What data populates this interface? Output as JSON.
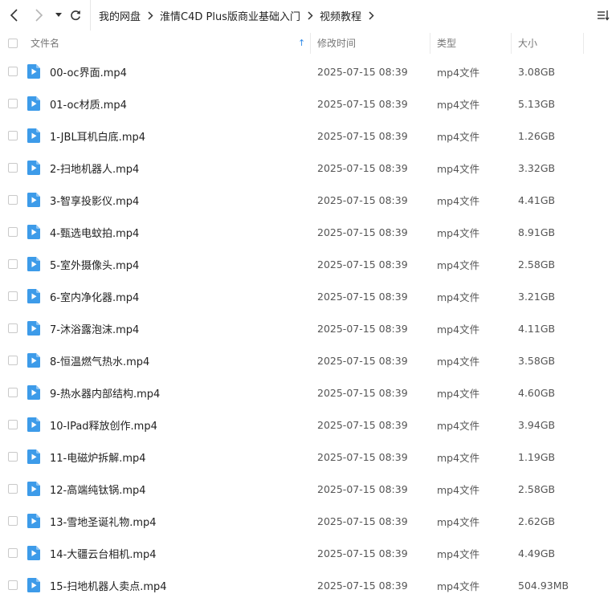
{
  "toolbar": {
    "back_icon": "chevron-left-icon",
    "forward_icon": "chevron-right-icon",
    "history_icon": "caret-down-icon",
    "refresh_icon": "refresh-icon",
    "sort_icon": "sort-list-icon",
    "breadcrumb": [
      "我的网盘",
      "淮情C4D Plus版商业基础入门",
      "视频教程"
    ]
  },
  "columns": {
    "name": "文件名",
    "modified": "修改时间",
    "type": "类型",
    "size": "大小",
    "sort_indicator": "↑"
  },
  "colors": {
    "file_icon": "#3d9be9",
    "sort_arrow": "#2f8ae8"
  },
  "files": [
    {
      "name": "00-oc界面.mp4",
      "modified": "2025-07-15 08:39",
      "type": "mp4文件",
      "size": "3.08GB"
    },
    {
      "name": "01-oc材质.mp4",
      "modified": "2025-07-15 08:39",
      "type": "mp4文件",
      "size": "5.13GB"
    },
    {
      "name": "1-JBL耳机白底.mp4",
      "modified": "2025-07-15 08:39",
      "type": "mp4文件",
      "size": "1.26GB"
    },
    {
      "name": "2-扫地机器人.mp4",
      "modified": "2025-07-15 08:39",
      "type": "mp4文件",
      "size": "3.32GB"
    },
    {
      "name": "3-智享投影仪.mp4",
      "modified": "2025-07-15 08:39",
      "type": "mp4文件",
      "size": "4.41GB"
    },
    {
      "name": "4-甄选电蚊拍.mp4",
      "modified": "2025-07-15 08:39",
      "type": "mp4文件",
      "size": "8.91GB"
    },
    {
      "name": "5-室外摄像头.mp4",
      "modified": "2025-07-15 08:39",
      "type": "mp4文件",
      "size": "2.58GB"
    },
    {
      "name": "6-室内净化器.mp4",
      "modified": "2025-07-15 08:39",
      "type": "mp4文件",
      "size": "3.21GB"
    },
    {
      "name": "7-沐浴露泡沫.mp4",
      "modified": "2025-07-15 08:39",
      "type": "mp4文件",
      "size": "4.11GB"
    },
    {
      "name": "8-恒温燃气热水.mp4",
      "modified": "2025-07-15 08:39",
      "type": "mp4文件",
      "size": "3.58GB"
    },
    {
      "name": "9-热水器内部结构.mp4",
      "modified": "2025-07-15 08:39",
      "type": "mp4文件",
      "size": "4.60GB"
    },
    {
      "name": "10-IPad释放创作.mp4",
      "modified": "2025-07-15 08:39",
      "type": "mp4文件",
      "size": "3.94GB"
    },
    {
      "name": "11-电磁炉拆解.mp4",
      "modified": "2025-07-15 08:39",
      "type": "mp4文件",
      "size": "1.19GB"
    },
    {
      "name": "12-高端纯钛锅.mp4",
      "modified": "2025-07-15 08:39",
      "type": "mp4文件",
      "size": "2.58GB"
    },
    {
      "name": "13-雪地圣诞礼物.mp4",
      "modified": "2025-07-15 08:39",
      "type": "mp4文件",
      "size": "2.62GB"
    },
    {
      "name": "14-大疆云台相机.mp4",
      "modified": "2025-07-15 08:39",
      "type": "mp4文件",
      "size": "4.49GB"
    },
    {
      "name": "15-扫地机器人卖点.mp4",
      "modified": "2025-07-15 08:39",
      "type": "mp4文件",
      "size": "504.93MB"
    }
  ]
}
